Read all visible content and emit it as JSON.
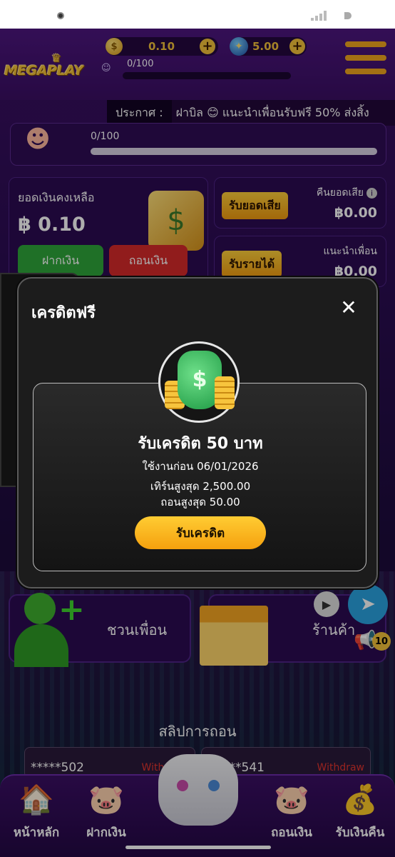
{
  "header": {
    "logo_text": "MEGAPLAY",
    "coin_balance": "0.10",
    "gem_balance": "5.00",
    "xp_text": "0/100"
  },
  "announcement": {
    "label": "ประกาศ :",
    "message": "ฝาบิล 😊 แนะนำเพื่อนรับฟรี 50% ส่งสิ้ง"
  },
  "level": {
    "progress_text": "0/100",
    "progress_fraction": 0
  },
  "balance_card": {
    "label": "ยอดเงินคงเหลือ",
    "value": "฿ 0.10",
    "deposit_label": "ฝากเงิน",
    "withdraw_label": "ถอนเงิน"
  },
  "cashback_card": {
    "button_label": "รับยอดเสีย",
    "label": "คืนยอดเสีย",
    "value": "฿0.00"
  },
  "referral_card": {
    "button_label": "รับรายได้",
    "label": "แนะนำเพื่อน",
    "value": "฿0.00"
  },
  "bottom_tiles": {
    "invite_label": "ชวนเพื่อน",
    "shop_label": "ร้านค้า",
    "notification_count": "10"
  },
  "slips": {
    "title": "สลิปการถอน",
    "items": [
      {
        "account": "*****502",
        "type": "Withdraw"
      },
      {
        "account": "***541",
        "type": "Withdraw"
      }
    ]
  },
  "nav": {
    "items": [
      {
        "label": "หน้าหลัก",
        "icon": "home-icon"
      },
      {
        "label": "ฝากเงิน",
        "icon": "deposit-pig-icon"
      },
      {
        "label": "ถอนเงิน",
        "icon": "withdraw-pig-icon"
      },
      {
        "label": "รับเงินคืน",
        "icon": "cashback-icon"
      }
    ]
  },
  "modal": {
    "title": "เครดิตฟรี",
    "heading": "รับเครดิต 50 บาท",
    "use_before": "ใช้งานก่อน 06/01/2026",
    "max_turnover": "เทิร์นสูงสุด 2,500.00",
    "max_withdraw": "ถอนสูงสุด 50.00",
    "claim_label": "รับเครดิต"
  },
  "colors": {
    "accent": "#f3c23a",
    "background": "#2b0d52",
    "deposit": "#2ea63a",
    "withdraw": "#d62a2a"
  }
}
